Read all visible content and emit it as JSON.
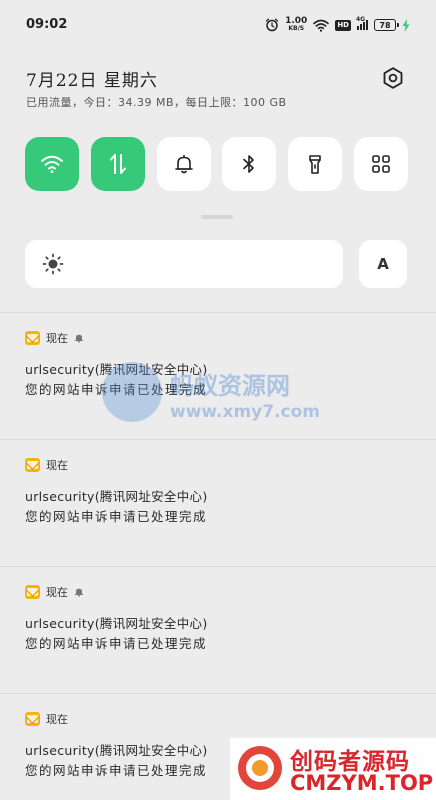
{
  "status_bar": {
    "time": "09:02",
    "net_speed_value": "1.00",
    "net_speed_unit": "KB/S",
    "hd_label": "HD",
    "signal_label": "4G",
    "battery_level": "78",
    "icons": [
      "alarm-icon",
      "wifi-icon",
      "hd-icon",
      "signal-icon",
      "battery-icon",
      "charging-icon"
    ]
  },
  "header": {
    "date": "7月22日  星期六",
    "usage": "已用流量，今日：34.39 MB，每日上限：100 GB"
  },
  "quick_tiles": [
    {
      "name": "wifi",
      "icon": "wifi-icon",
      "active": true
    },
    {
      "name": "mobile-data",
      "icon": "data-arrows-icon",
      "active": true
    },
    {
      "name": "sound",
      "icon": "bell-icon",
      "active": false
    },
    {
      "name": "bluetooth",
      "icon": "bluetooth-icon",
      "active": false
    },
    {
      "name": "flashlight",
      "icon": "flashlight-icon",
      "active": false
    },
    {
      "name": "more",
      "icon": "grid-icon",
      "active": false
    }
  ],
  "brightness": {
    "auto_label": "A"
  },
  "notifications": [
    {
      "time": "现在",
      "muted": true,
      "title": "urlsecurity(腾讯网址安全中心)",
      "body": "您的网站申诉申请已处理完成"
    },
    {
      "time": "现在",
      "muted": false,
      "title": "urlsecurity(腾讯网址安全中心)",
      "body": "您的网站申诉申请已处理完成"
    },
    {
      "time": "现在",
      "muted": true,
      "title": "urlsecurity(腾讯网址安全中心)",
      "body": "您的网站申诉申请已处理完成"
    },
    {
      "time": "现在",
      "muted": false,
      "title": "urlsecurity(腾讯网址安全中心)",
      "body": "您的网站申诉申请已处理完成"
    }
  ],
  "watermarks": {
    "center_cn": "蚂蚁资源网",
    "center_url": "www.xmy7.com",
    "bottom_cn": "创码者源码",
    "bottom_url": "CMZYM.TOP"
  },
  "colors": {
    "tile_active": "#36c97a",
    "background": "#ececec",
    "mail_icon": "#f6b316"
  }
}
